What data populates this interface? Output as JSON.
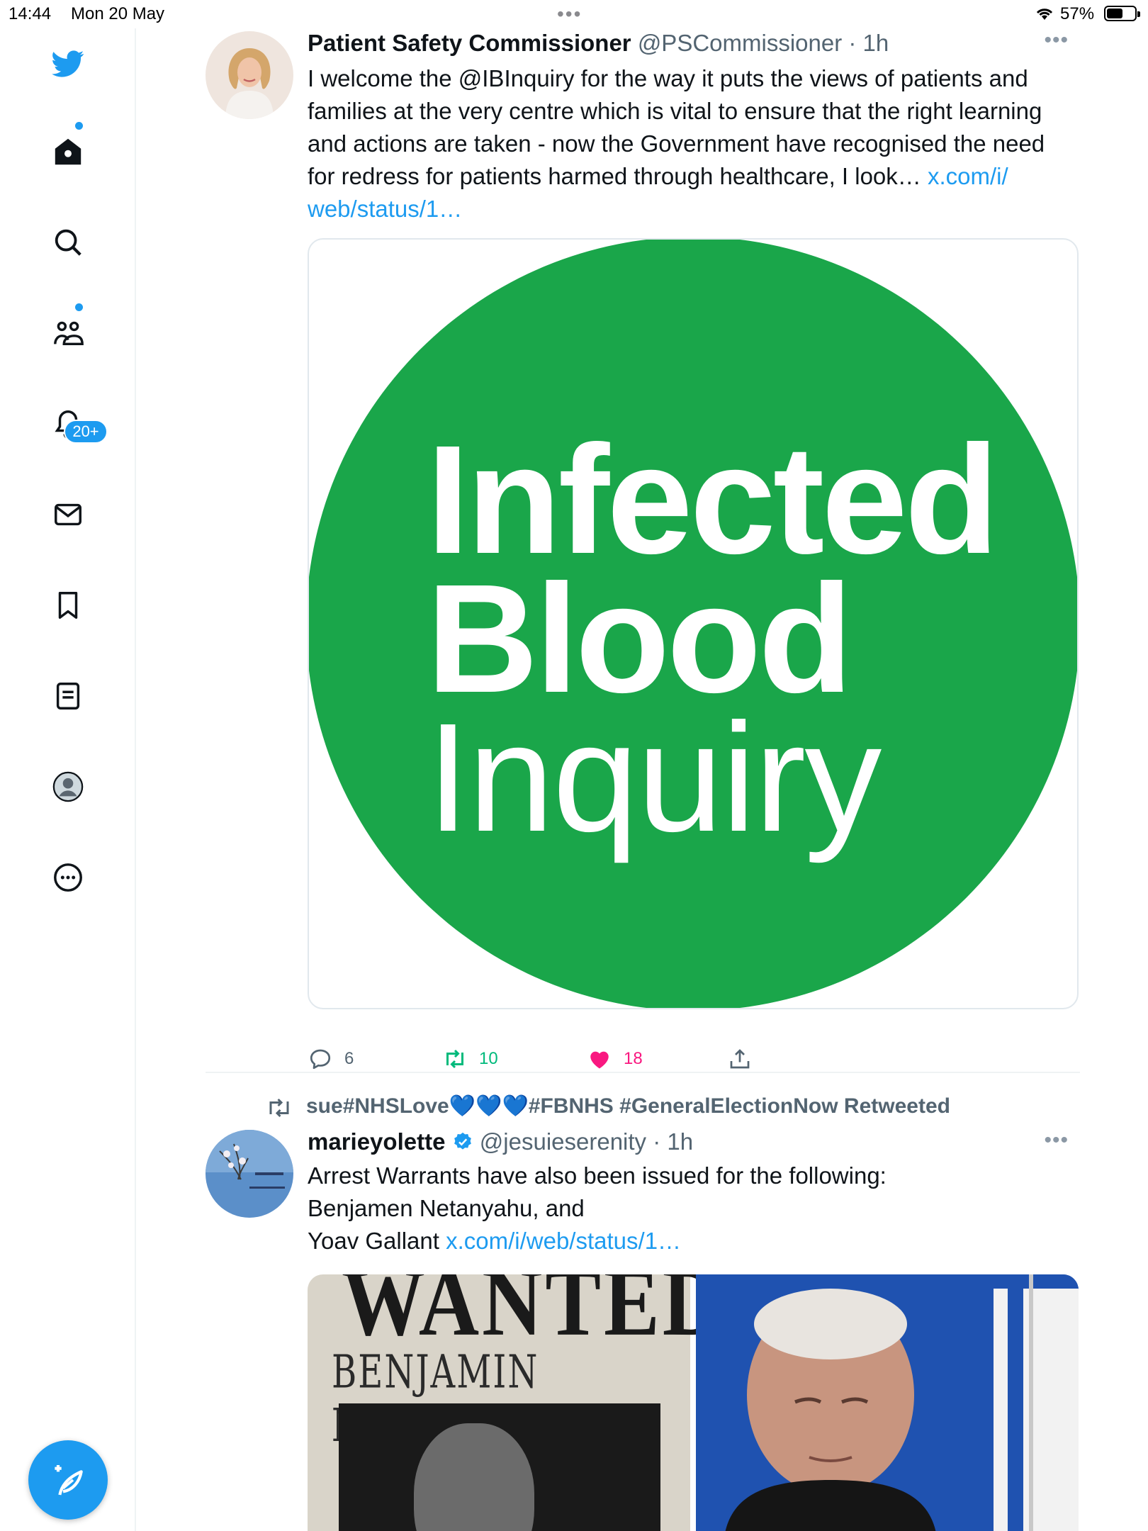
{
  "status_bar": {
    "time": "14:44",
    "date": "Mon 20 May",
    "battery": "57%",
    "battery_level": 0.57
  },
  "sidebar": {
    "icons": [
      "twitter-bird-icon",
      "home-icon",
      "search-icon",
      "communities-icon",
      "notifications-icon",
      "messages-icon",
      "bookmarks-icon",
      "lists-icon",
      "profile-icon",
      "more-icon"
    ],
    "notifications_badge": "20+"
  },
  "tweets": [
    {
      "name": "Patient Safety Commissioner",
      "handle": "@PSCommissioner",
      "time": "1h",
      "text_lines": [
        "I welcome the @IBInquiry for the way  it puts the views of patients and",
        "families at the very centre which is vital to ensure that the right learning",
        "and actions are taken - now the Government have recognised the need",
        "for redress for patients harmed through healthcare, I look… "
      ],
      "link_part1": "x.com/i/",
      "link_part2": "web/status/1…",
      "media": {
        "line1": "Infected",
        "line2": "Blood",
        "line3": "Inquiry",
        "color": "#1aa64a"
      },
      "replies": "6",
      "retweets": "10",
      "likes": "18"
    },
    {
      "retweeted_by": "sue#NHSLove💙💙💙#FBNHS #GeneralElectionNow Retweeted",
      "name": "marieyolette",
      "handle": "@jesuieserenity",
      "time": "1h",
      "text_line1": "Arrest Warrants have also been issued for the following:",
      "text_line2": "Benjamen Netanyahu, and",
      "text_line3": "Yoav Gallant ",
      "link": "x.com/i/web/status/1…",
      "media": {
        "wanted": "WANTED",
        "wanted_name": "BENJAMIN NETANYAHU"
      }
    }
  ],
  "colors": {
    "accent": "#1d9bf0",
    "like": "#f91880",
    "retweet": "#00ba7c",
    "muted": "#536471"
  }
}
